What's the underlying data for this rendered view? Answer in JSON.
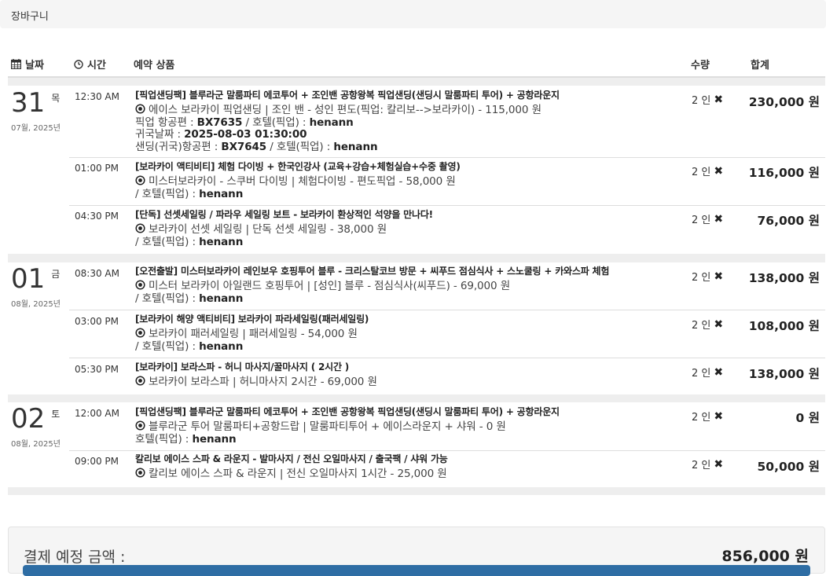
{
  "breadcrumb": "장바구니",
  "headers": {
    "date": "날짜",
    "time": "시간",
    "product": "예약 상품",
    "qty": "수량",
    "total": "합계",
    "date_icon": "calendar-icon",
    "time_icon": "clock-icon"
  },
  "days": [
    {
      "day": "31",
      "weekday": "목",
      "month_year": "07월, 2025년",
      "items": [
        {
          "time": "12:30 AM",
          "title": "[픽업샌딩팩] 블루라군 말룸파티 에코투어 + 조인밴 공항왕복 픽업샌딩(샌딩시 말룸파티 투어) + 공항라운지",
          "option": "에이스 보라카이 픽업샌딩 | 조인 밴 - 성인 편도(픽업: 칼리보-->보라카이) - 115,000 원",
          "details": [
            {
              "label": "픽업 항공편 : ",
              "value": "BX7635",
              "label2": " / 호텔(픽업) : ",
              "value2": "henann"
            },
            {
              "label": "귀국날짜 : ",
              "value": "2025-08-03 01:30:00",
              "label2": "",
              "value2": ""
            },
            {
              "label": "샌딩(귀국)항공편 : ",
              "value": "BX7645",
              "label2": " / 호텔(픽업) : ",
              "value2": "henann"
            }
          ],
          "qty": "2 인",
          "total": "230,000 원"
        },
        {
          "time": "01:00 PM",
          "title": "[보라카이 액티비티] 체험 다이빙 + 한국인강사 (교육+강습+체험실습+수중 촬영)",
          "option": "미스터보라카이 - 스쿠버 다이빙 | 체험다이빙 - 편도픽업 - 58,000 원",
          "details": [
            {
              "label": "/ 호텔(픽업) : ",
              "value": "henann",
              "label2": "",
              "value2": ""
            }
          ],
          "qty": "2 인",
          "total": "116,000 원"
        },
        {
          "time": "04:30 PM",
          "title": "[단독] 선셋세일링 / 파라우 세일링 보트 - 보라카이 환상적인 석양을 만나다!",
          "option": "보라카이 선셋 세일링 | 단독 선셋 세일링 - 38,000 원",
          "details": [
            {
              "label": "/ 호텔(픽업) : ",
              "value": "henann",
              "label2": "",
              "value2": ""
            }
          ],
          "qty": "2 인",
          "total": "76,000 원"
        }
      ]
    },
    {
      "day": "01",
      "weekday": "금",
      "month_year": "08월, 2025년",
      "items": [
        {
          "time": "08:30 AM",
          "title": "[오전출발] 미스터보라카이 레인보우 호핑투어 블루 - 크리스탈코브 방문 + 씨푸드 점심식사 + 스노쿨링 + 카와스파 체험",
          "option": "미스터 보라카이 아일랜드 호핑투어 | [성인] 블루 - 점심식사(씨푸드) - 69,000 원",
          "details": [
            {
              "label": "/ 호텔(픽업) : ",
              "value": "henann",
              "label2": "",
              "value2": ""
            }
          ],
          "qty": "2 인",
          "total": "138,000 원"
        },
        {
          "time": "03:00 PM",
          "title": "[보라카이 해양 액티비티] 보라카이 파라세일링(패러세일링)",
          "option": "보라카이 패러세일링 | 패러세일링 - 54,000 원",
          "details": [
            {
              "label": "/ 호텔(픽업) : ",
              "value": "henann",
              "label2": "",
              "value2": ""
            }
          ],
          "qty": "2 인",
          "total": "108,000 원"
        },
        {
          "time": "05:30 PM",
          "title": "[보라카이] 보라스파 - 허니 마사지/꿀마사지 ( 2시간 )",
          "option": "보라카이 보라스파 | 허니마사지 2시간 - 69,000 원",
          "details": [],
          "qty": "2 인",
          "total": "138,000 원"
        }
      ]
    },
    {
      "day": "02",
      "weekday": "토",
      "month_year": "08월, 2025년",
      "items": [
        {
          "time": "12:00 AM",
          "title": "[픽업샌딩팩] 블루라군 말룸파티 에코투어 + 조인밴 공항왕복 픽업샌딩(샌딩시 말룸파티 투어) + 공항라운지",
          "option": "블루라군 투어 말룸파티+공항드랍 | 말룸파티투어 + 에이스라운지 + 샤워 - 0 원",
          "details": [
            {
              "label": "호텔(픽업) : ",
              "value": "henann",
              "label2": "",
              "value2": ""
            }
          ],
          "qty": "2 인",
          "total": "0 원"
        },
        {
          "time": "09:00 PM",
          "title": "칼리보 에이스 스파 & 라운지 - 발마사지 / 전신 오일마사지 / 출국팩 / 샤워 가능",
          "option": "칼리보 에이스 스파 & 라운지 | 전신 오일마사지 1시간 - 25,000 원",
          "details": [],
          "qty": "2 인",
          "total": "50,000 원"
        }
      ]
    }
  ],
  "summary": {
    "label": "결제 예정 금액 :",
    "amount": "856,000 원"
  },
  "icons": {
    "option": "option-radio-icon",
    "remove": "remove-x-icon"
  },
  "colors": {
    "band": "#eeeeee",
    "accent": "#2e6da4"
  }
}
